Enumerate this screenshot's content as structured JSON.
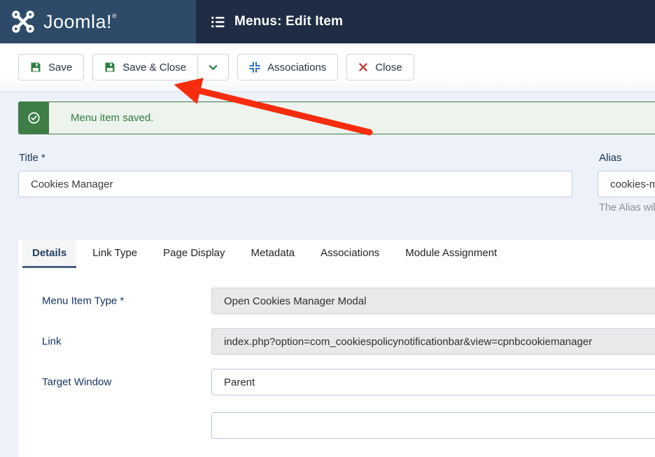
{
  "header": {
    "brand": "Joomla!",
    "brand_mark": "®",
    "page_title": "Menus: Edit Item"
  },
  "toolbar": {
    "save_label": "Save",
    "save_close_label": "Save & Close",
    "associations_label": "Associations",
    "close_label": "Close"
  },
  "alert": {
    "message": "Menu item saved."
  },
  "title_field": {
    "label": "Title *",
    "value": "Cookies Manager"
  },
  "alias_field": {
    "label": "Alias",
    "value": "cookies-m",
    "help": "The Alias will"
  },
  "tabs": [
    {
      "label": "Details",
      "active": true
    },
    {
      "label": "Link Type",
      "active": false
    },
    {
      "label": "Page Display",
      "active": false
    },
    {
      "label": "Metadata",
      "active": false
    },
    {
      "label": "Associations",
      "active": false
    },
    {
      "label": "Module Assignment",
      "active": false
    }
  ],
  "details_form": {
    "rows": [
      {
        "label": "Menu Item Type *",
        "value": "Open Cookies Manager Modal",
        "readonly": true
      },
      {
        "label": "Link",
        "value": "index.php?option=com_cookiespolicynotificationbar&view=cpnbcookiemanager",
        "readonly": true
      },
      {
        "label": "Target Window",
        "value": "Parent",
        "readonly": false
      }
    ]
  },
  "colors": {
    "header_left_bg": "#2d4a68",
    "header_right_bg": "#1e2d44",
    "page_bg": "#edf1f9",
    "success_green": "#3f7d46",
    "success_bg": "#edf3ed",
    "accent_blue": "#2f6fc0",
    "danger_red": "#c63936",
    "arrow_red": "#f52d0e",
    "label_navy": "#16335c",
    "tab_underline": "#4b5e7e"
  }
}
